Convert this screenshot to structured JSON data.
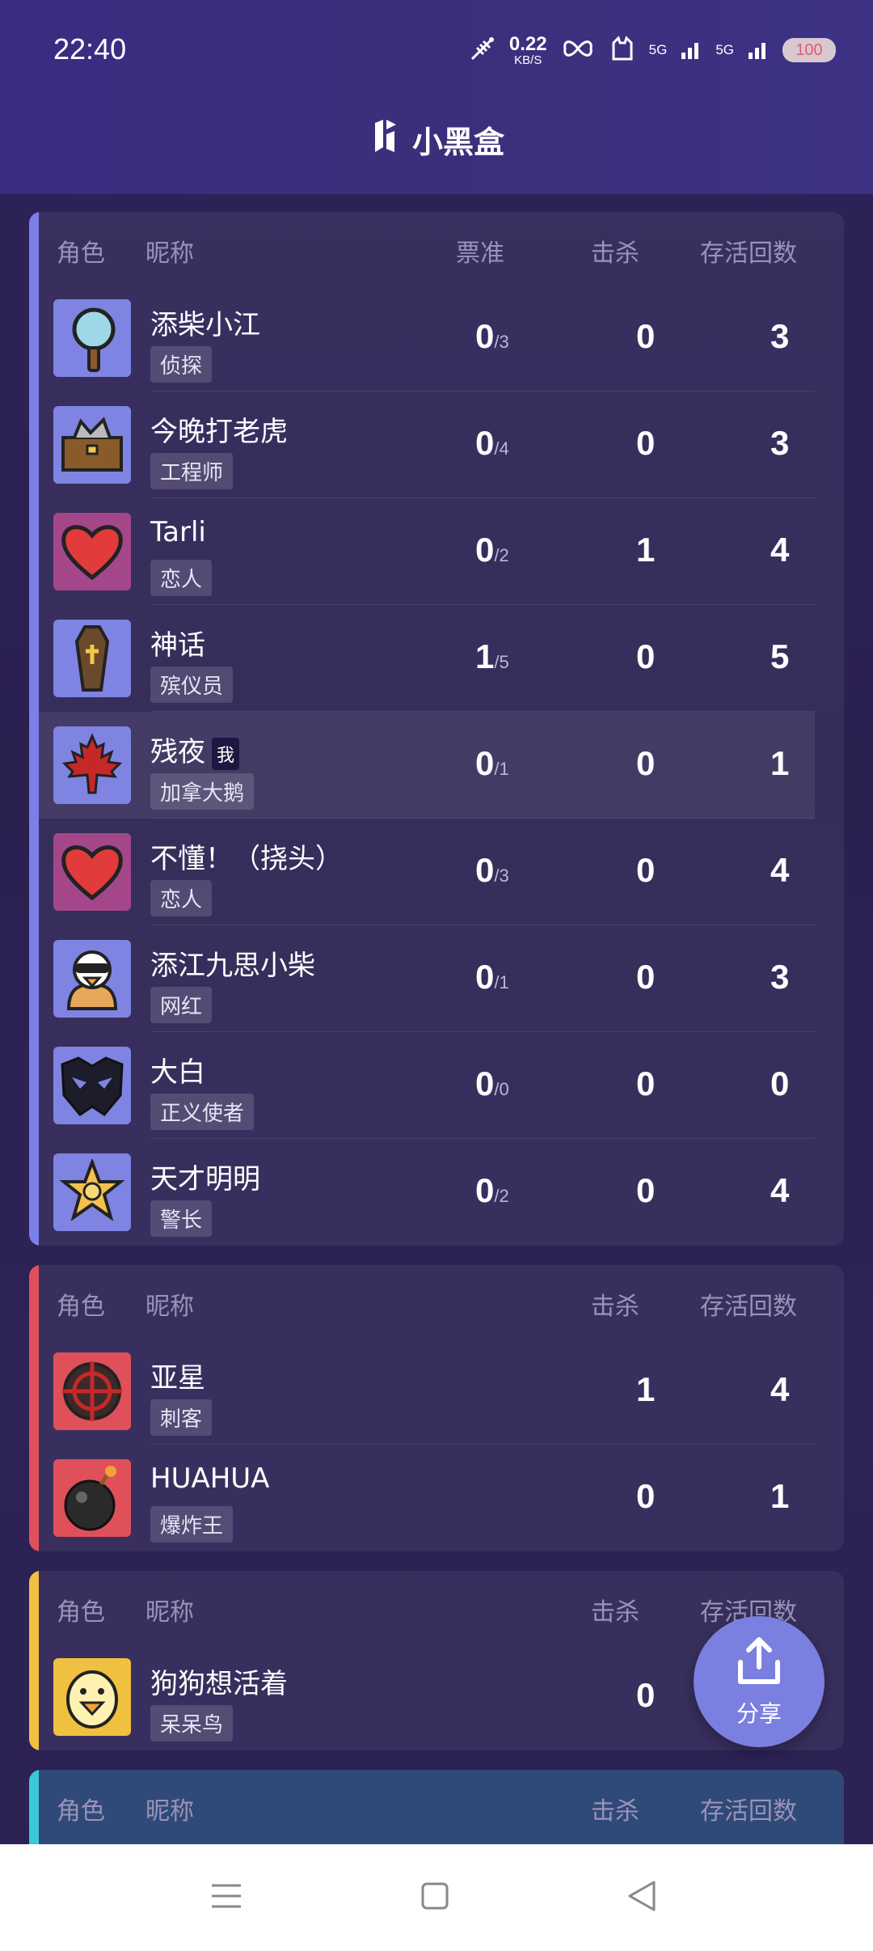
{
  "status_bar": {
    "time": "22:40",
    "net_speed_value": "0.22",
    "net_speed_unit": "KB/S",
    "signal1": "5G",
    "signal2": "5G",
    "battery": "100"
  },
  "header": {
    "brand_name": "小黑盒"
  },
  "columns": {
    "role": "角色",
    "nickname": "昵称",
    "vote": "票准",
    "kill": "击杀",
    "survive": "存活回数"
  },
  "team1": {
    "accent": "#7b80e8",
    "players": [
      {
        "nick": "添柴小江",
        "role": "侦探",
        "vote": "0",
        "vote_total": "/3",
        "kill": "0",
        "survive": "3",
        "icon": "magnifier-icon"
      },
      {
        "nick": "今晚打老虎",
        "role": "工程师",
        "vote": "0",
        "vote_total": "/4",
        "kill": "0",
        "survive": "3",
        "icon": "toolbox-icon"
      },
      {
        "nick": "Tarli",
        "role": "恋人",
        "vote": "0",
        "vote_total": "/2",
        "kill": "1",
        "survive": "4",
        "icon": "heart-icon"
      },
      {
        "nick": "神话",
        "role": "殡仪员",
        "vote": "1",
        "vote_total": "/5",
        "kill": "0",
        "survive": "5",
        "icon": "coffin-icon"
      },
      {
        "nick": "残夜",
        "role": "加拿大鹅",
        "vote": "0",
        "vote_total": "/1",
        "kill": "0",
        "survive": "1",
        "icon": "maple-leaf-icon",
        "me_tag": "我"
      },
      {
        "nick": "不懂！（挠头）",
        "role": "恋人",
        "vote": "0",
        "vote_total": "/3",
        "kill": "0",
        "survive": "4",
        "icon": "heart-icon"
      },
      {
        "nick": "添江九思小柴",
        "role": "网红",
        "vote": "0",
        "vote_total": "/1",
        "kill": "0",
        "survive": "3",
        "icon": "influencer-goose-icon"
      },
      {
        "nick": "大白",
        "role": "正义使者",
        "vote": "0",
        "vote_total": "/0",
        "kill": "0",
        "survive": "0",
        "icon": "mask-icon"
      },
      {
        "nick": "天才明明",
        "role": "警长",
        "vote": "0",
        "vote_total": "/2",
        "kill": "0",
        "survive": "4",
        "icon": "sheriff-star-icon"
      }
    ]
  },
  "team2": {
    "accent": "#e0505a",
    "players": [
      {
        "nick": "亚星",
        "role": "刺客",
        "kill": "1",
        "survive": "4",
        "icon": "crosshair-icon"
      },
      {
        "nick": "HUAHUA",
        "role": "爆炸王",
        "kill": "0",
        "survive": "1",
        "icon": "bomb-icon"
      }
    ]
  },
  "team3": {
    "accent": "#f0c040",
    "players": [
      {
        "nick": "狗狗想活着",
        "role": "呆呆鸟",
        "kill": "0",
        "survive": "",
        "icon": "dodo-bird-icon"
      }
    ]
  },
  "team4": {
    "accent": "#3cc8d8"
  },
  "share": {
    "label": "分享"
  }
}
